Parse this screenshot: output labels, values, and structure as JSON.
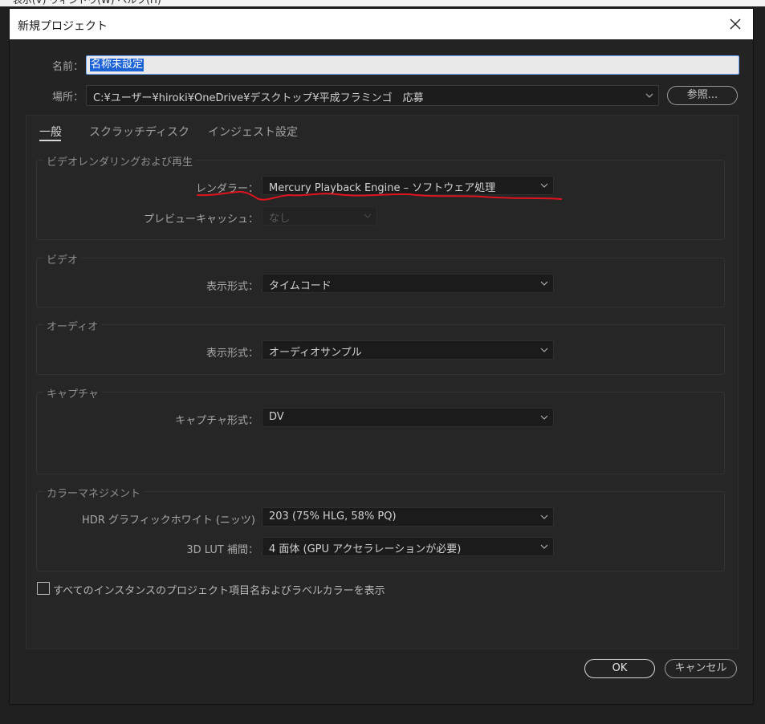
{
  "menubar": {
    "text": "ー 表示(V)  ウィンドウ(W)  ヘルプ(H)"
  },
  "dialog": {
    "title": "新規プロジェクト"
  },
  "name": {
    "label": "名前：",
    "value": "名称未設定"
  },
  "location": {
    "label": "場所：",
    "value": "C:¥ユーザー¥hiroki¥OneDrive¥デスクトップ¥平成フラミンゴ　応募",
    "browse_label": "参照..."
  },
  "tabs": [
    {
      "label": "一般",
      "active": true
    },
    {
      "label": "スクラッチディスク",
      "active": false
    },
    {
      "label": "インジェスト設定",
      "active": false
    }
  ],
  "groups": {
    "video_rendering": {
      "title": "ビデオレンダリングおよび再生",
      "renderer_label": "レンダラー：",
      "renderer_value": "Mercury Playback Engine – ソフトウェア処理",
      "preview_cache_label": "プレビューキャッシュ：",
      "preview_cache_value": "なし"
    },
    "video": {
      "title": "ビデオ",
      "display_format_label": "表示形式：",
      "display_format_value": "タイムコード"
    },
    "audio": {
      "title": "オーディオ",
      "display_format_label": "表示形式：",
      "display_format_value": "オーディオサンプル"
    },
    "capture": {
      "title": "キャプチャ",
      "capture_format_label": "キャプチャ形式：",
      "capture_format_value": "DV"
    },
    "color": {
      "title": "カラーマネジメント",
      "hdr_label": "HDR グラフィックホワイト (ニッツ)",
      "hdr_value": "203 (75% HLG, 58% PQ)",
      "lut_label": "3D LUT 補間：",
      "lut_value": "4 面体 (GPU アクセラレーションが必要)"
    }
  },
  "show_labels_checkbox": {
    "label": "すべてのインスタンスのプロジェクト項目名およびラベルカラーを表示",
    "checked": false
  },
  "buttons": {
    "ok": "OK",
    "cancel": "キャンセル"
  },
  "colors": {
    "annotation_red": "#e0141e",
    "selection_blue": "#1c63d6",
    "focus_blue": "#6aa5ff"
  }
}
